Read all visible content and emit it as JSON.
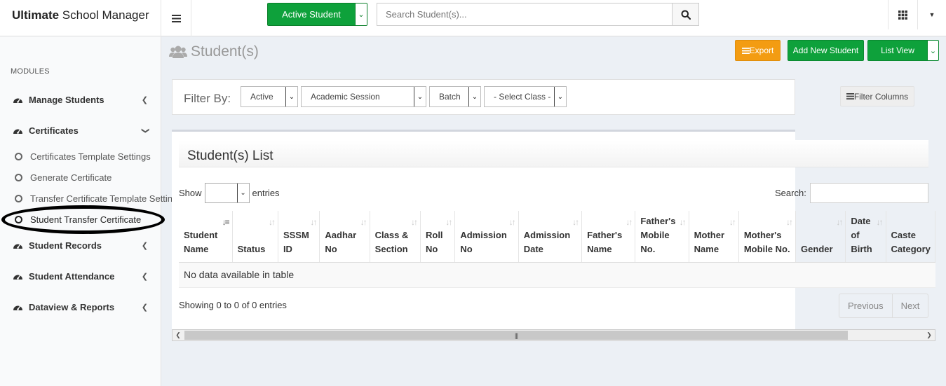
{
  "brand": {
    "bold": "Ultimate",
    "rest": " School Manager"
  },
  "topbar": {
    "status_button": "Active Student",
    "search_placeholder": "Search Student(s)..."
  },
  "sidebar": {
    "section_label": "MODULES",
    "items": [
      {
        "label": "Manage Students",
        "icon": "dashboard-icon",
        "state": "collapsed"
      },
      {
        "label": "Certificates",
        "icon": "dashboard-icon",
        "state": "expanded"
      },
      {
        "label": "Student Records",
        "icon": "dashboard-icon",
        "state": "collapsed"
      },
      {
        "label": "Student Attendance",
        "icon": "dashboard-icon",
        "state": "collapsed"
      },
      {
        "label": "Dataview & Reports",
        "icon": "dashboard-icon",
        "state": "collapsed"
      }
    ],
    "sub_items": [
      "Certificates Template Settings",
      "Generate Certificate",
      "Transfer Certificate Template Settings",
      "Student Transfer Certificate"
    ],
    "highlighted_sub_item": "Student Transfer Certificate"
  },
  "page": {
    "title": "Student(s)",
    "export_label": "Export",
    "add_label": "Add New Student",
    "view_label": "List View"
  },
  "filter": {
    "label": "Filter By:",
    "status": "Active",
    "session": "Academic Session",
    "batch": "Batch",
    "class": "- Select Class -",
    "columns_label": "Filter Columns"
  },
  "list": {
    "title": "Student(s) List",
    "show_label": "Show",
    "entries_label": "entries",
    "search_label": "Search:",
    "columns": [
      "Student Name",
      "Status",
      "SSSM ID",
      "Aadhar No",
      "Class & Section",
      "Roll No",
      "Admission No",
      "Admission Date",
      "Father's Name",
      "Father's Mobile No.",
      "Mother Name",
      "Mother's Mobile No.",
      "Gender",
      "Date of Birth",
      "Caste Category"
    ],
    "empty_message": "No data available in table",
    "info": "Showing 0 to 0 of 0 entries",
    "prev": "Previous",
    "next": "Next"
  }
}
